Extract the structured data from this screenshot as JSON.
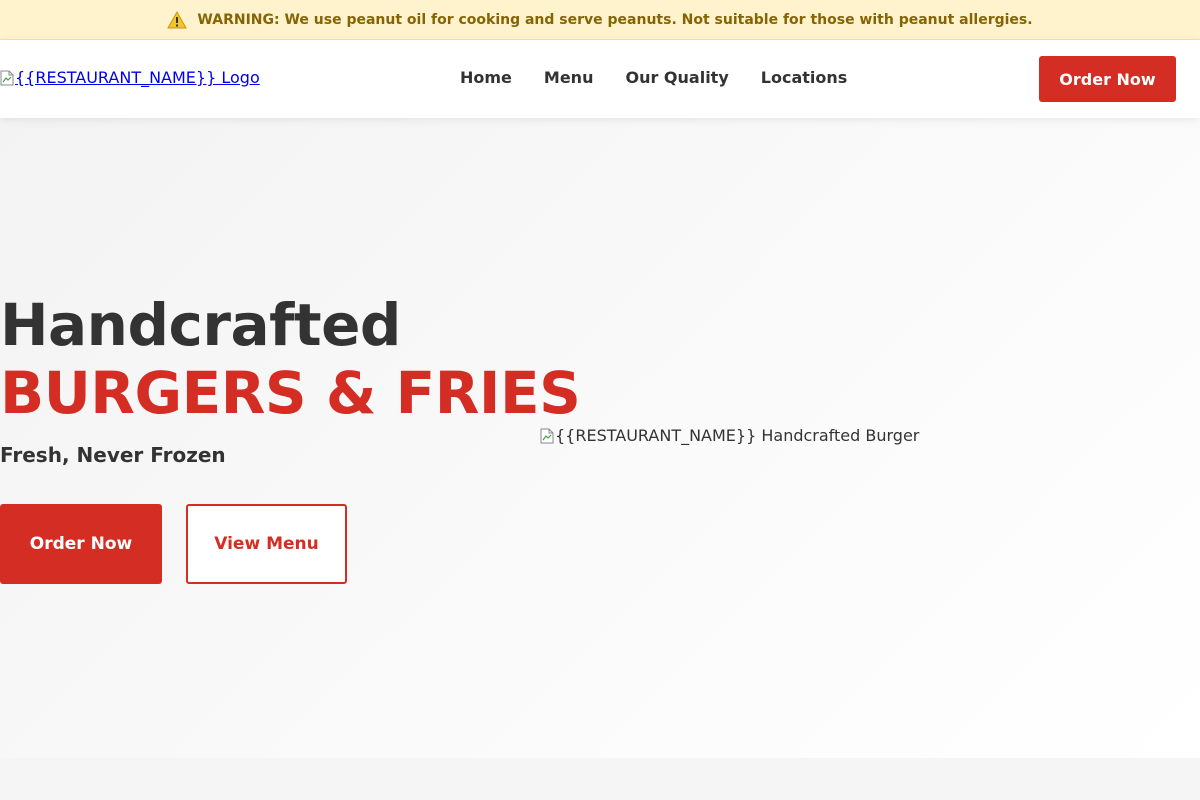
{
  "warning_banner": {
    "icon": "warning-icon",
    "text": "WARNING: We use peanut oil for cooking and serve peanuts. Not suitable for those with peanut allergies."
  },
  "header": {
    "logo_alt": "{{RESTAURANT_NAME}} Logo",
    "nav": [
      {
        "label": "Home"
      },
      {
        "label": "Menu"
      },
      {
        "label": "Our Quality"
      },
      {
        "label": "Locations"
      }
    ],
    "order_button": "Order Now"
  },
  "hero": {
    "title_line1": "Handcrafted",
    "title_line2": "BURGERS & FRIES",
    "subtitle": "Fresh, Never Frozen",
    "order_button": "Order Now",
    "menu_button": "View Menu",
    "image_alt": "{{RESTAURANT_NAME}} Handcrafted Burger"
  },
  "colors": {
    "brand_red": "#d42e24",
    "warning_bg": "#fff3cd",
    "warning_text": "#856404",
    "text_dark": "#333333"
  }
}
